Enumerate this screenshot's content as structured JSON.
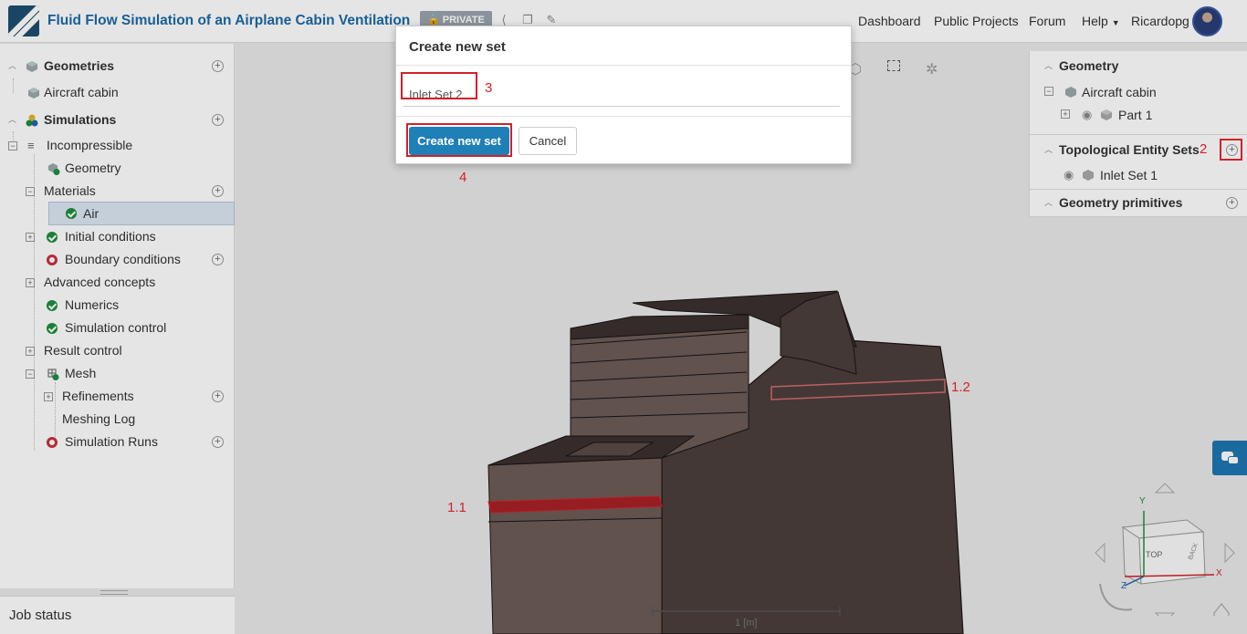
{
  "header": {
    "title": "Fluid Flow Simulation of an Airplane Cabin Ventilation",
    "badge": "PRIVATE",
    "nav": [
      "Dashboard",
      "Public Projects",
      "Forum",
      "Help",
      "Ricardopg"
    ]
  },
  "tree": {
    "geometries_label": "Geometries",
    "geometry_item": "Aircraft cabin",
    "simulations_label": "Simulations",
    "incompressible": "Incompressible",
    "geometry": "Geometry",
    "materials": "Materials",
    "air": "Air",
    "initial_conditions": "Initial conditions",
    "boundary_conditions": "Boundary conditions",
    "advanced_concepts": "Advanced concepts",
    "numerics": "Numerics",
    "simulation_control": "Simulation control",
    "result_control": "Result control",
    "mesh": "Mesh",
    "refinements": "Refinements",
    "meshing_log": "Meshing Log",
    "simulation_runs": "Simulation Runs"
  },
  "job_status": "Job status",
  "right_panel": {
    "geometry": "Geometry",
    "aircraft_cabin": "Aircraft cabin",
    "part": "Part 1",
    "topological_sets": "Topological Entity Sets",
    "inlet_set_1": "Inlet Set 1",
    "geometry_primitives": "Geometry primitives"
  },
  "dialog": {
    "title": "Create new set",
    "input_value": "Inlet Set 2",
    "create_label": "Create new set",
    "cancel_label": "Cancel"
  },
  "annotations": [
    "1.1",
    "1.2",
    "2",
    "3",
    "4"
  ],
  "viewport": {
    "scale_label": "1 [m]",
    "cube_front": "TOP",
    "cube_side": "BACK",
    "axis_x": "X",
    "axis_y": "Y",
    "axis_z": "Z"
  },
  "colors": {
    "brand": "#1b6aa8",
    "primary_button": "#1f7fb7",
    "annotation": "#d3202a",
    "ok": "#1e8e3e",
    "error": "#c6303e"
  }
}
